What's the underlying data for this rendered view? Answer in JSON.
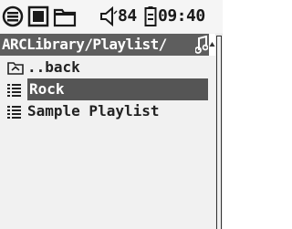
{
  "status": {
    "icons": [
      "browser-icon",
      "stop-icon",
      "folder-icon"
    ],
    "volume_icon": "speaker-icon",
    "volume_value": "84",
    "battery_icon": "battery-icon",
    "clock": "09:40"
  },
  "path": {
    "text": "ARCLibrary/Playlist/",
    "icon": "music-note-icon",
    "scroll_icon": "up-arrow-icon"
  },
  "list": {
    "items": [
      {
        "label": "..back",
        "icon": "folder-up-icon",
        "selected": false
      },
      {
        "label": "Rock",
        "icon": "playlist-icon",
        "selected": true
      },
      {
        "label": "Sample Playlist",
        "icon": "playlist-icon",
        "selected": false
      }
    ]
  },
  "colors": {
    "path_bar_bg": "#5e5e5e",
    "selection_bg": "#555555",
    "screen_bg": "#f1f1f1"
  }
}
